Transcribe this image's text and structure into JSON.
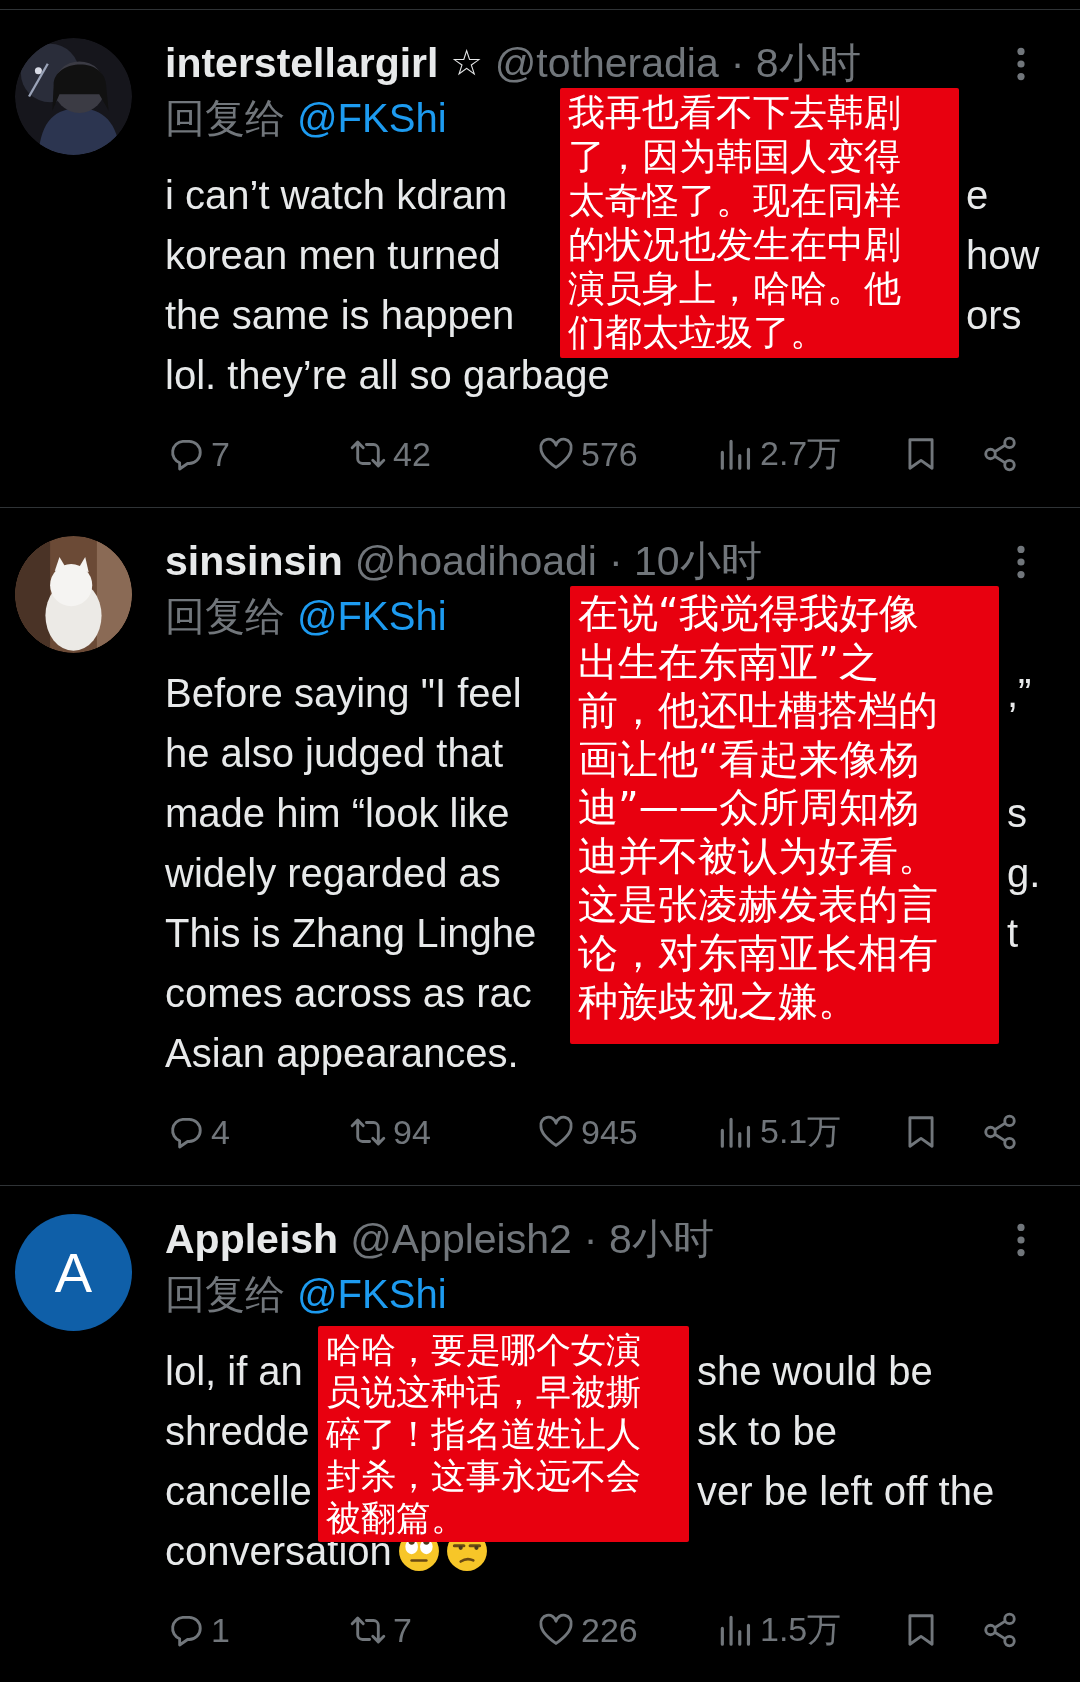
{
  "tweets": [
    {
      "name": "interstellargirl",
      "badge": "☆",
      "handle": "@totheradia",
      "time": "· 8小时",
      "reply_label": "回复给",
      "reply_to": "@FKShi",
      "body_lines": [
        {
          "left": "i can’t watch kdram",
          "right": "e"
        },
        {
          "left": "korean men turned",
          "right": "how"
        },
        {
          "left": "the same is happen",
          "right": "ors"
        },
        {
          "left": "lol. they’re all so garbage"
        }
      ],
      "stats": {
        "replies": "7",
        "reposts": "42",
        "likes": "576",
        "views": "2.7万"
      },
      "note": "我再也看不下去韩剧了，因为韩国人变得太奇怪了。现在同样的状况也发生在中剧演员身上，哈哈。他们都太垃圾了。"
    },
    {
      "name": "sinsinsin",
      "handle": "@hoadihoadi",
      "time": "· 10小时",
      "reply_label": "回复给",
      "reply_to": "@FKShi",
      "body_lines": [
        {
          "left": "Before saying \"I feel",
          "right": ",”"
        },
        {
          "left": "he also judged that"
        },
        {
          "left": "made him “look like",
          "right": "s"
        },
        {
          "left": "widely regarded as",
          "right": "g."
        },
        {
          "left": "This is Zhang Linghe",
          "right": "t"
        },
        {
          "left": "comes across as rac"
        },
        {
          "left": "Asian appearances."
        }
      ],
      "stats": {
        "replies": "4",
        "reposts": "94",
        "likes": "945",
        "views": "5.1万"
      },
      "note": "在说“我觉得我好像出生在东南亚”之前，他还吐槽搭档的画让他“看起来像杨迪”——众所周知杨迪并不被认为好看。这是张凌赫发表的言论，对东南亚长相有种族歧视之嫌。"
    },
    {
      "avatar": {
        "kind": "letter",
        "letter": "A"
      },
      "name": "Appleish",
      "handle": "@Appleish2",
      "time": "· 8小时",
      "reply_label": "回复给",
      "reply_to": "@FKShi",
      "body_lines": [
        {
          "left": "lol, if an",
          "right": "she would be"
        },
        {
          "left": "shredde",
          "right": "sk to be"
        },
        {
          "left": "cancelle",
          "right": "ver be left off the"
        },
        {
          "left": "conversation",
          "emojis": [
            {
              "kind": "eyeroll"
            },
            {
              "kind": "unamused"
            }
          ]
        }
      ],
      "stats": {
        "replies": "1",
        "reposts": "7",
        "likes": "226",
        "views": "1.5万"
      },
      "note": "哈哈，要是哪个女演员说这种话，早被撕碎了！指名道姓让人封杀，这事永远不会被翻篇。"
    }
  ]
}
